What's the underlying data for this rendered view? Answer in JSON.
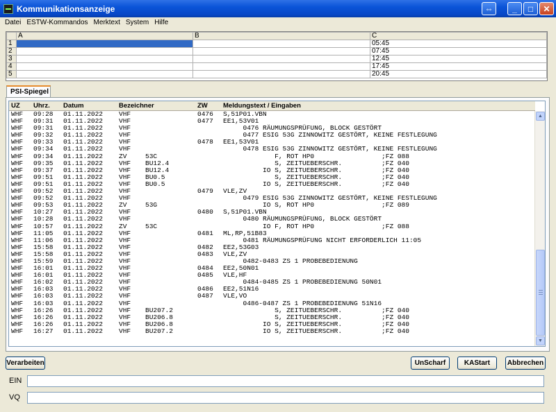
{
  "window": {
    "title": "Kommunikationsanzeige"
  },
  "menu": [
    "Datei",
    "ESTW-Kommandos",
    "Merktext",
    "System",
    "Hilfe"
  ],
  "grid": {
    "columns": [
      "A",
      "B",
      "C"
    ],
    "rows": [
      {
        "n": "1",
        "a": "",
        "b": "",
        "c": "05:45"
      },
      {
        "n": "2",
        "a": "",
        "b": "",
        "c": "07:45"
      },
      {
        "n": "3",
        "a": "",
        "b": "",
        "c": "12:45"
      },
      {
        "n": "4",
        "a": "",
        "b": "",
        "c": "17:45"
      },
      {
        "n": "5",
        "a": "",
        "b": "",
        "c": "20:45"
      }
    ]
  },
  "tab": {
    "label": "PSI-Spiegel"
  },
  "list": {
    "headers": {
      "uz": "UZ",
      "time": "Uhrz.",
      "date": "Datum",
      "name": "Bezeichner",
      "zw": "ZW",
      "msg": "Meldungstext / Eingaben"
    },
    "rows": [
      {
        "uz": "WHF",
        "t": "09:28",
        "d": "01.11.2022",
        "b": "VHF",
        "id": "",
        "zw": "0476",
        "m": "S,51P01.VBN"
      },
      {
        "uz": "WHF",
        "t": "09:31",
        "d": "01.11.2022",
        "b": "VHF",
        "id": "",
        "zw": "0477",
        "m": "EE1,53V01"
      },
      {
        "uz": "WHF",
        "t": "09:31",
        "d": "01.11.2022",
        "b": "VHF",
        "id": "",
        "zw": "",
        "m": "     0476 RÄUMUNGSPRÜFUNG, BLOCK GESTÖRT"
      },
      {
        "uz": "WHF",
        "t": "09:32",
        "d": "01.11.2022",
        "b": "VHF",
        "id": "",
        "zw": "",
        "m": "     0477 ESIG 53G ZINNOWITZ GESTÖRT, KEINE FESTLEGUNG"
      },
      {
        "uz": "WHF",
        "t": "09:33",
        "d": "01.11.2022",
        "b": "VHF",
        "id": "",
        "zw": "0478",
        "m": "EE1,53V01"
      },
      {
        "uz": "WHF",
        "t": "09:34",
        "d": "01.11.2022",
        "b": "VHF",
        "id": "",
        "zw": "",
        "m": "     0478 ESIG 53G ZINNOWITZ GESTÖRT, KEINE FESTLEGUNG"
      },
      {
        "uz": "WHF",
        "t": "09:34",
        "d": "01.11.2022",
        "b": "ZV",
        "id": "53C",
        "zw": "",
        "m": "             F, ROT HP0                 ;FZ 088"
      },
      {
        "uz": "WHF",
        "t": "09:35",
        "d": "01.11.2022",
        "b": "VHF",
        "id": "BU12.4",
        "zw": "",
        "m": "             S, ZEITUEBERSCHR.          ;FZ 040"
      },
      {
        "uz": "WHF",
        "t": "09:37",
        "d": "01.11.2022",
        "b": "VHF",
        "id": "BU12.4",
        "zw": "",
        "m": "          IO S, ZEITUEBERSCHR.          ;FZ 040"
      },
      {
        "uz": "WHF",
        "t": "09:51",
        "d": "01.11.2022",
        "b": "VHF",
        "id": "BU0.5",
        "zw": "",
        "m": "             S, ZEITUEBERSCHR.          ;FZ 040"
      },
      {
        "uz": "WHF",
        "t": "09:51",
        "d": "01.11.2022",
        "b": "VHF",
        "id": "BU0.5",
        "zw": "",
        "m": "          IO S, ZEITUEBERSCHR.          ;FZ 040"
      },
      {
        "uz": "WHF",
        "t": "09:52",
        "d": "01.11.2022",
        "b": "VHF",
        "id": "",
        "zw": "0479",
        "m": "VLE,ZV"
      },
      {
        "uz": "WHF",
        "t": "09:52",
        "d": "01.11.2022",
        "b": "VHF",
        "id": "",
        "zw": "",
        "m": "     0479 ESIG 53G ZINNOWITZ GESTÖRT, KEINE FESTLEGUNG"
      },
      {
        "uz": "WHF",
        "t": "09:53",
        "d": "01.11.2022",
        "b": "ZV",
        "id": "53G",
        "zw": "",
        "m": "          IO S, ROT HP0                 ;FZ 089"
      },
      {
        "uz": "WHF",
        "t": "10:27",
        "d": "01.11.2022",
        "b": "VHF",
        "id": "",
        "zw": "0480",
        "m": "S,51P01.VBN"
      },
      {
        "uz": "WHF",
        "t": "10:28",
        "d": "01.11.2022",
        "b": "VHF",
        "id": "",
        "zw": "",
        "m": "     0480 RÄUMUNGSPRÜFUNG, BLOCK GESTÖRT"
      },
      {
        "uz": "WHF",
        "t": "10:57",
        "d": "01.11.2022",
        "b": "ZV",
        "id": "53C",
        "zw": "",
        "m": "          IO F, ROT HP0                 ;FZ 088"
      },
      {
        "uz": "WHF",
        "t": "11:05",
        "d": "01.11.2022",
        "b": "VHF",
        "id": "",
        "zw": "0481",
        "m": "ML,RP,51B83"
      },
      {
        "uz": "WHF",
        "t": "11:06",
        "d": "01.11.2022",
        "b": "VHF",
        "id": "",
        "zw": "",
        "m": "     0481 RÄUMUNGSPRÜFUNG NICHT ERFORDERLICH 11:05"
      },
      {
        "uz": "WHF",
        "t": "15:58",
        "d": "01.11.2022",
        "b": "VHF",
        "id": "",
        "zw": "0482",
        "m": "EE2,53G03"
      },
      {
        "uz": "WHF",
        "t": "15:58",
        "d": "01.11.2022",
        "b": "VHF",
        "id": "",
        "zw": "0483",
        "m": "VLE,ZV"
      },
      {
        "uz": "WHF",
        "t": "15:59",
        "d": "01.11.2022",
        "b": "VHF",
        "id": "",
        "zw": "",
        "m": "     0482-0483 ZS 1 PROBEBEDIENUNG"
      },
      {
        "uz": "WHF",
        "t": "16:01",
        "d": "01.11.2022",
        "b": "VHF",
        "id": "",
        "zw": "0484",
        "m": "EE2,50N01"
      },
      {
        "uz": "WHF",
        "t": "16:01",
        "d": "01.11.2022",
        "b": "VHF",
        "id": "",
        "zw": "0485",
        "m": "VLE,HF"
      },
      {
        "uz": "WHF",
        "t": "16:02",
        "d": "01.11.2022",
        "b": "VHF",
        "id": "",
        "zw": "",
        "m": "     0484-0485 ZS 1 PROBEBEDIENUNG 50N01"
      },
      {
        "uz": "WHF",
        "t": "16:03",
        "d": "01.11.2022",
        "b": "VHF",
        "id": "",
        "zw": "0486",
        "m": "EE2,51N16"
      },
      {
        "uz": "WHF",
        "t": "16:03",
        "d": "01.11.2022",
        "b": "VHF",
        "id": "",
        "zw": "0487",
        "m": "VLE,VO"
      },
      {
        "uz": "WHF",
        "t": "16:03",
        "d": "01.11.2022",
        "b": "VHF",
        "id": "",
        "zw": "",
        "m": "     0486-0487 ZS 1 PROBEBEDIENUNG 51N16"
      },
      {
        "uz": "WHF",
        "t": "16:26",
        "d": "01.11.2022",
        "b": "VHF",
        "id": "BU207.2",
        "zw": "",
        "m": "             S, ZEITUEBERSCHR.          ;FZ 040"
      },
      {
        "uz": "WHF",
        "t": "16:26",
        "d": "01.11.2022",
        "b": "VHF",
        "id": "BU206.8",
        "zw": "",
        "m": "             S, ZEITUEBERSCHR.          ;FZ 040"
      },
      {
        "uz": "WHF",
        "t": "16:26",
        "d": "01.11.2022",
        "b": "VHF",
        "id": "BU206.8",
        "zw": "",
        "m": "          IO S, ZEITUEBERSCHR.          ;FZ 040"
      },
      {
        "uz": "WHF",
        "t": "16:27",
        "d": "01.11.2022",
        "b": "VHF",
        "id": "BU207.2",
        "zw": "",
        "m": "          IO S, ZEITUEBERSCHR.          ;FZ 040"
      }
    ]
  },
  "buttons": {
    "verarbeiten": "Verarbeiten",
    "unscharf": "UnScharf",
    "kastart": "KAStart",
    "abbrechen": "Abbrechen"
  },
  "inputs": {
    "ein_label": "EIN",
    "ein_value": "",
    "vq_label": "VQ",
    "vq_value": ""
  }
}
